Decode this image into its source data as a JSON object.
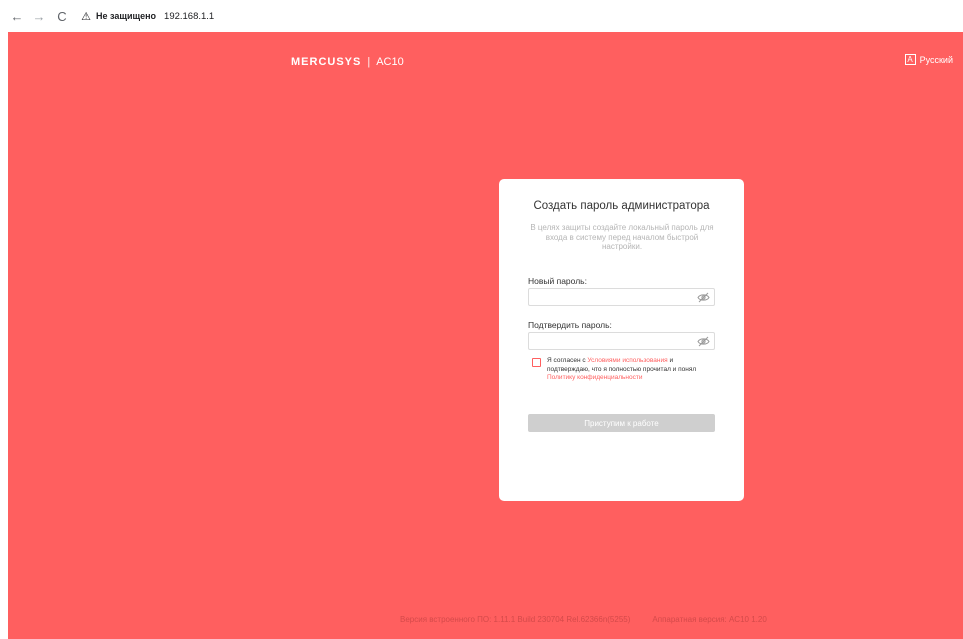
{
  "browser": {
    "back_icon": "←",
    "forward_icon": "→",
    "reload_icon": "C",
    "warning_icon": "⚠",
    "security_label": "Не защищено",
    "url": "192.168.1.1"
  },
  "header": {
    "brand_logo": "MERCUSYS",
    "separator": "|",
    "model": "AC10",
    "language_icon_letter": "A",
    "language": "Русский"
  },
  "card": {
    "title": "Создать пароль администратора",
    "description": "В целях защиты создайте локальный пароль для входа в систему перед началом быстрой настройки.",
    "new_password_label": "Новый пароль:",
    "new_password_value": "",
    "confirm_password_label": "Подтвердить пароль:",
    "confirm_password_value": "",
    "agree": {
      "checked": false,
      "text_before": "Я согласен с ",
      "terms_link": "Условиями использования",
      "text_middle": " и подтверждаю, что я полностью прочитал и понял ",
      "privacy_link": "Политику конфиденциальности"
    },
    "submit_label": "Приступим к работе"
  },
  "footer": {
    "firmware": "Версия встроенного ПО: 1.11.1 Build 230704 Rel.62366n(5255)",
    "hardware": "Аппаратная версия: AC10 1.20"
  },
  "colors": {
    "background": "#ff5f5f",
    "card": "#ffffff",
    "button_disabled": "#cfcfcf",
    "link": "#ff5f5f"
  }
}
